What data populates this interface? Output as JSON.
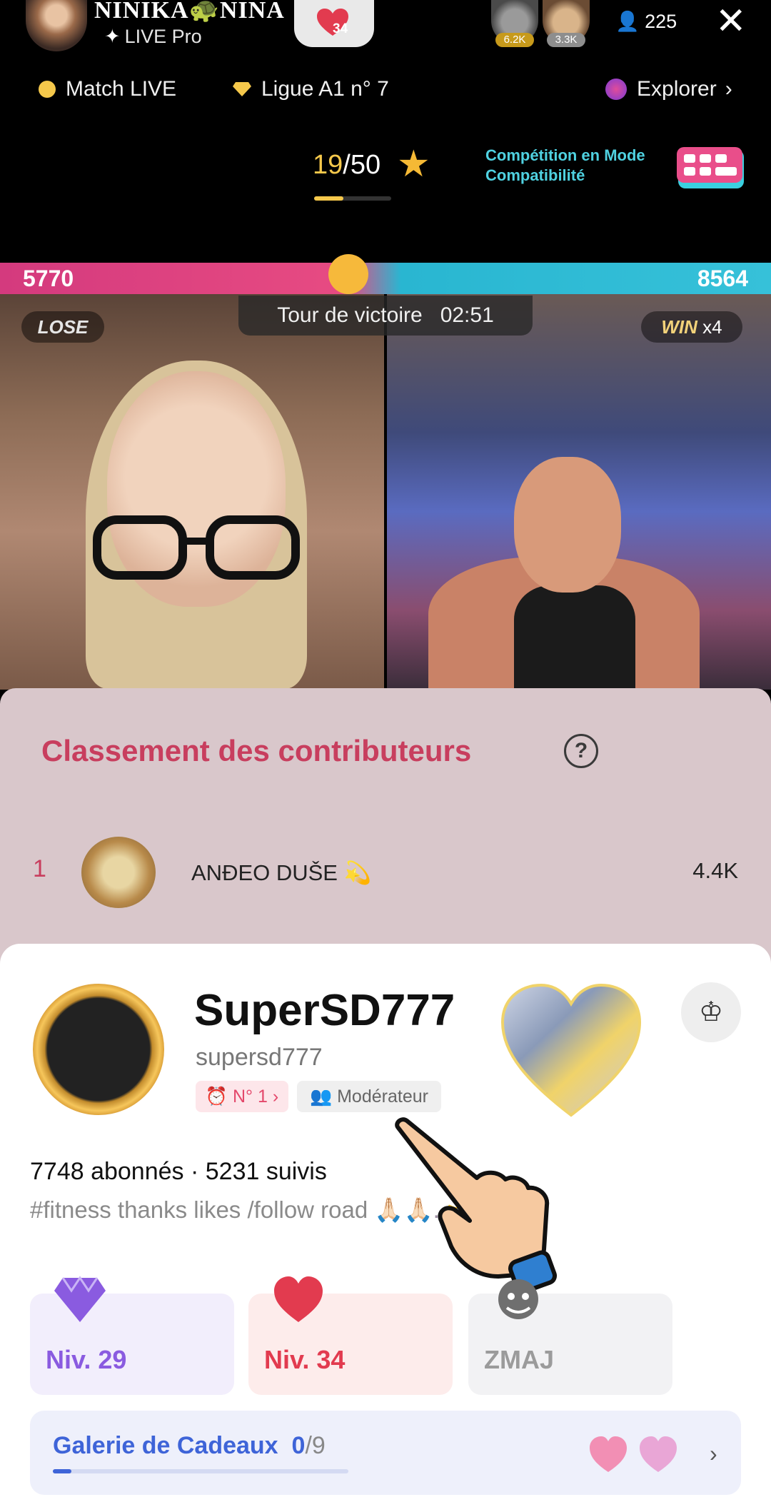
{
  "host": {
    "name": "NINIKA🐢NINA",
    "badge": "LIVE Pro",
    "like_level": "34",
    "viewers": [
      {
        "count": "6.2K"
      },
      {
        "count": "3.3K"
      }
    ],
    "viewer_count": "225"
  },
  "nav": {
    "match": "Match LIVE",
    "league": "Ligue A1 n° 7",
    "explore": "Explorer"
  },
  "progress": {
    "done": "19",
    "total": "/50",
    "fraction": 0.38
  },
  "competition": {
    "line1": "Compétition en Mode",
    "line2": "Compatibilité"
  },
  "battle": {
    "score_left": "5770",
    "score_right": "8564",
    "left_result": "LOSE",
    "right_result": "WIN",
    "right_multiplier": "x4",
    "victory_label": "Tour de victoire",
    "victory_time": "02:51"
  },
  "leaderboard": {
    "title": "Classement des contributeurs",
    "help": "?",
    "entries": [
      {
        "rank": "1",
        "name": "ANĐEO DUŠE 💫",
        "score": "4.4K"
      }
    ]
  },
  "profile": {
    "display_name": "SuperSD777",
    "handle": "supersd777",
    "rank_tag": "N° 1",
    "role_tag": "Modérateur",
    "follow_line": "7748 abonnés · 5231 suivis",
    "bio": "#fitness thanks likes /follow road",
    "bio_tail": "🙏🏻🙏🏻. 🤸",
    "levels": [
      {
        "label": "Niv. 29",
        "color": "#8a5be0",
        "bg": "#f2eefc"
      },
      {
        "label": "Niv. 34",
        "color": "#e23b4f",
        "bg": "#fdeceb"
      },
      {
        "label": "ZMAJ",
        "color": "#9b9b9b",
        "bg": "#f2f2f4"
      }
    ],
    "gallery_title": "Galerie de Cadeaux",
    "gallery_count": "0",
    "gallery_total": "/9",
    "gallery_fraction": 0
  },
  "colors": {
    "accent_pink": "#c83e5e",
    "win_gold": "#f2d27a",
    "gallery_blue": "#3e64d8"
  },
  "icons": [
    "close-icon",
    "people-icon",
    "star-icon",
    "chevron-right-icon",
    "help-icon",
    "crown-icon",
    "hand-pointer-icon"
  ]
}
